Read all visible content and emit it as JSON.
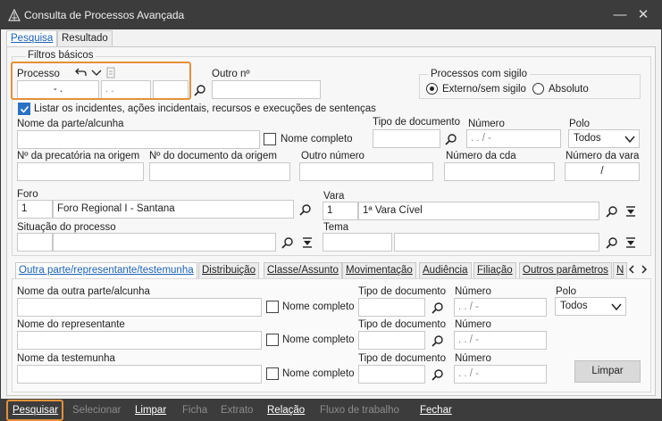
{
  "window": {
    "title": "Consulta de Processos Avançada",
    "minimize": "—",
    "close": "✕"
  },
  "tabs": [
    {
      "label": "Pesquisa"
    },
    {
      "label": "Resultado"
    }
  ],
  "filtros": {
    "group_label": "Filtros básicos",
    "processo_label": "Processo",
    "processo_p1": "- .",
    "processo_p2": ". .",
    "outro_label": "Outro nº",
    "listar_label": "Listar os incidentes, ações incidentais, recursos e execuções de sentenças",
    "sigilo_label": "Processos com sigilo",
    "sigilo_externo": "Externo/sem sigilo",
    "sigilo_absoluto": "Absoluto",
    "nome_parte_label": "Nome da parte/alcunha",
    "nome_completo": "Nome completo",
    "tipo_doc_label": "Tipo de documento",
    "numero_label": "Número",
    "numero_mask": ". . / -",
    "polo_label": "Polo",
    "polo_value": "Todos",
    "precatoria_label": "Nº da precatória na origem",
    "doc_origem_label": "Nº do documento da origem",
    "outro_numero_label": "Outro número",
    "cda_label": "Número da cda",
    "numero_vara_label": "Número da vara",
    "numero_vara_mask": "/",
    "foro_label": "Foro",
    "foro_code": "1",
    "foro_name": "Foro Regional I - Santana",
    "vara_label": "Vara",
    "vara_code": "1",
    "vara_name": "1ª Vara Cível",
    "situacao_label": "Situação do processo",
    "tema_label": "Tema"
  },
  "subtabs": [
    {
      "label": "Outra parte/representante/testemunha"
    },
    {
      "label": "Distribuição"
    },
    {
      "label": "Classe/Assunto"
    },
    {
      "label": "Movimentação"
    },
    {
      "label": "Audiência"
    },
    {
      "label": "Filiação"
    },
    {
      "label": "Outros parâmetros"
    },
    {
      "label": "N"
    }
  ],
  "outra": {
    "nome_outra_label": "Nome da outra parte/alcunha",
    "nome_repr_label": "Nome do representante",
    "nome_test_label": "Nome da testemunha",
    "nome_completo": "Nome completo",
    "tipo_doc_label": "Tipo de documento",
    "numero_label": "Número",
    "numero_mask": ". . / -",
    "polo_label": "Polo",
    "polo_value": "Todos",
    "limpar": "Limpar"
  },
  "footer": [
    {
      "label": "Pesquisar",
      "enabled": true
    },
    {
      "label": "Selecionar",
      "enabled": false
    },
    {
      "label": "Limpar",
      "enabled": true
    },
    {
      "label": "Ficha",
      "enabled": false
    },
    {
      "label": "Extrato",
      "enabled": false
    },
    {
      "label": "Relação",
      "enabled": true
    },
    {
      "label": "Fluxo de trabalho",
      "enabled": false
    },
    {
      "label": "Fechar",
      "enabled": true
    }
  ],
  "colors": {
    "titlebar": "#3c3c3c",
    "accent": "#2a71c6",
    "highlight": "#e3913a"
  }
}
